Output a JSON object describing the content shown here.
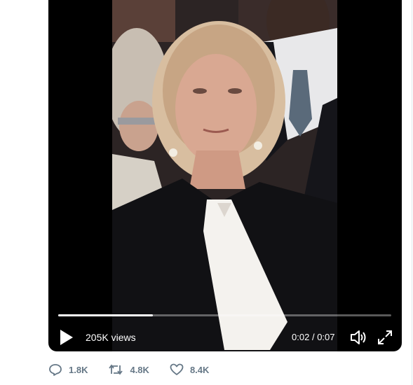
{
  "video": {
    "views": "205K views",
    "time_current": "0:02",
    "time_separator": "/",
    "time_total": "0:07",
    "progress_fraction": 0.285,
    "play_icon": "play-icon",
    "volume_icon": "volume-icon",
    "fullscreen_icon": "fullscreen-icon"
  },
  "actions": {
    "reply_count": "1.8K",
    "retweet_count": "4.8K",
    "like_count": "8.4K"
  },
  "colors": {
    "video_background": "#000000",
    "action_gray": "#657786"
  }
}
